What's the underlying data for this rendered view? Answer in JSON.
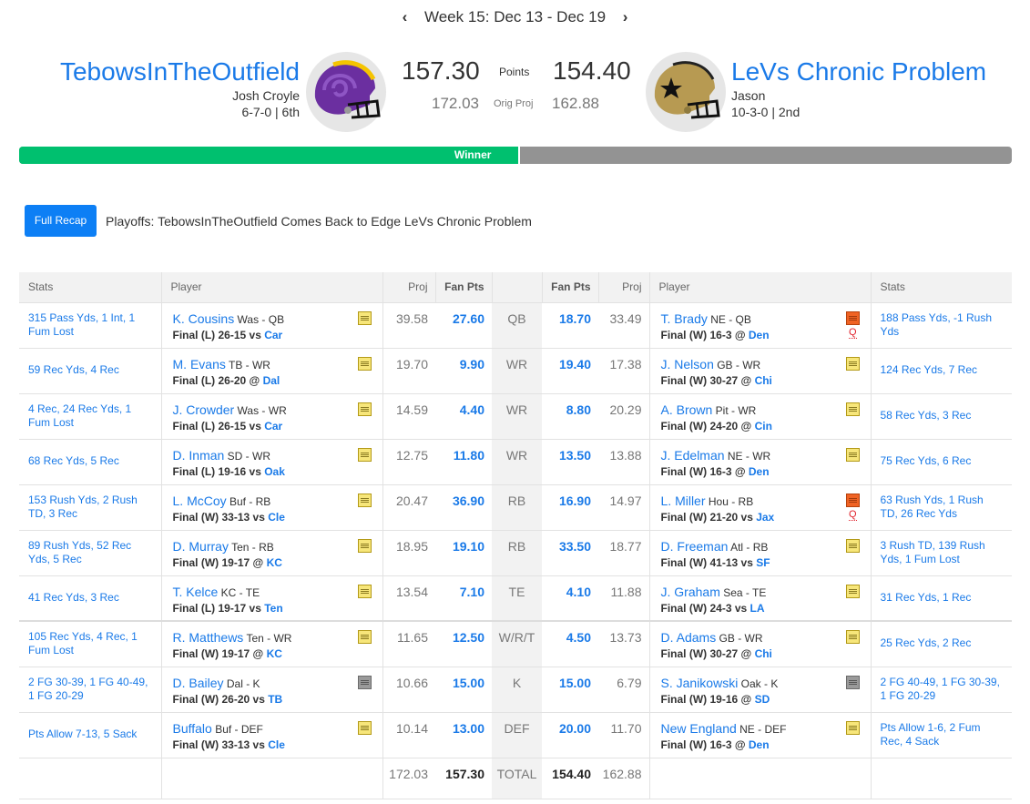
{
  "week_nav": {
    "prev_icon": "chevron-left-icon",
    "label": "Week 15: Dec 13 - Dec 19",
    "next_icon": "chevron-right-icon"
  },
  "matchup": {
    "left": {
      "team_name": "TebowsInTheOutfield",
      "owner": "Josh Croyle",
      "record": "6-7-0 | 6th",
      "helmet_colors": {
        "shell": "#6b2fa0",
        "stripe": "#f5c400"
      },
      "points": "157.30",
      "orig_proj": "172.03"
    },
    "right": {
      "team_name": "LeVs Chronic Problem",
      "owner": "Jason",
      "record": "10-3-0 | 2nd",
      "helmet_colors": {
        "shell": "#b79a52",
        "stripe": "#222222"
      },
      "points": "154.40",
      "orig_proj": "162.88"
    },
    "points_label": "Points",
    "orig_proj_label": "Orig Proj",
    "winner_label": "Winner",
    "winner_share_percent": 50.5,
    "colors": {
      "winner": "#00c06f",
      "loser": "#939393",
      "link": "#1a7ae8"
    }
  },
  "recap": {
    "button_label": "Full Recap",
    "headline": "Playoffs: TebowsInTheOutfield Comes Back to Edge LeVs Chronic Problem"
  },
  "table": {
    "headers": {
      "stats_left": "Stats",
      "player_left": "Player",
      "proj_left": "Proj",
      "fanpts_left": "Fan Pts",
      "pos": "",
      "fanpts_right": "Fan Pts",
      "proj_right": "Proj",
      "player_right": "Player",
      "stats_right": "Stats"
    },
    "rows": [
      {
        "pos": "QB",
        "left": {
          "stats": "315 Pass Yds, 1 Int, 1 Fum Lost",
          "name": "K. Cousins",
          "info": "Was - QB",
          "game": "Final (L) 26-15 vs ",
          "opp": "Car",
          "note": "yellow",
          "status": "",
          "proj": "39.58",
          "pts": "27.60"
        },
        "right": {
          "stats": "188 Pass Yds, -1 Rush Yds",
          "name": "T. Brady",
          "info": "NE - QB",
          "game": "Final (W) 16-3 @ ",
          "opp": "Den",
          "note": "orange",
          "status": "Q",
          "proj": "33.49",
          "pts": "18.70"
        }
      },
      {
        "pos": "WR",
        "left": {
          "stats": "59 Rec Yds, 4 Rec",
          "name": "M. Evans",
          "info": "TB - WR",
          "game": "Final (L) 26-20 @ ",
          "opp": "Dal",
          "note": "yellow",
          "status": "",
          "proj": "19.70",
          "pts": "9.90"
        },
        "right": {
          "stats": "124 Rec Yds, 7 Rec",
          "name": "J. Nelson",
          "info": "GB - WR",
          "game": "Final (W) 30-27 @ ",
          "opp": "Chi",
          "note": "yellow",
          "status": "",
          "proj": "17.38",
          "pts": "19.40"
        }
      },
      {
        "pos": "WR",
        "left": {
          "stats": "4 Rec, 24 Rec Yds, 1 Fum Lost",
          "name": "J. Crowder",
          "info": "Was - WR",
          "game": "Final (L) 26-15 vs ",
          "opp": "Car",
          "note": "yellow",
          "status": "",
          "proj": "14.59",
          "pts": "4.40"
        },
        "right": {
          "stats": "58 Rec Yds, 3 Rec",
          "name": "A. Brown",
          "info": "Pit - WR",
          "game": "Final (W) 24-20 @ ",
          "opp": "Cin",
          "note": "yellow",
          "status": "",
          "proj": "20.29",
          "pts": "8.80"
        }
      },
      {
        "pos": "WR",
        "left": {
          "stats": "68 Rec Yds, 5 Rec",
          "name": "D. Inman",
          "info": "SD - WR",
          "game": "Final (L) 19-16 vs ",
          "opp": "Oak",
          "note": "yellow",
          "status": "",
          "proj": "12.75",
          "pts": "11.80"
        },
        "right": {
          "stats": "75 Rec Yds, 6 Rec",
          "name": "J. Edelman",
          "info": "NE - WR",
          "game": "Final (W) 16-3 @ ",
          "opp": "Den",
          "note": "yellow",
          "status": "",
          "proj": "13.88",
          "pts": "13.50"
        }
      },
      {
        "pos": "RB",
        "left": {
          "stats": "153 Rush Yds, 2 Rush TD, 3 Rec",
          "name": "L. McCoy",
          "info": "Buf - RB",
          "game": "Final (W) 33-13 vs ",
          "opp": "Cle",
          "note": "yellow",
          "status": "",
          "proj": "20.47",
          "pts": "36.90"
        },
        "right": {
          "stats": "63 Rush Yds, 1 Rush TD, 26 Rec Yds",
          "name": "L. Miller",
          "info": "Hou - RB",
          "game": "Final (W) 21-20 vs ",
          "opp": "Jax",
          "note": "orange",
          "status": "Q",
          "proj": "14.97",
          "pts": "16.90"
        }
      },
      {
        "pos": "RB",
        "left": {
          "stats": "89 Rush Yds, 52 Rec Yds, 5 Rec",
          "name": "D. Murray",
          "info": "Ten - RB",
          "game": "Final (W) 19-17 @ ",
          "opp": "KC",
          "note": "yellow",
          "status": "",
          "proj": "18.95",
          "pts": "19.10"
        },
        "right": {
          "stats": "3 Rush TD, 139 Rush Yds, 1 Fum Lost",
          "name": "D. Freeman",
          "info": "Atl - RB",
          "game": "Final (W) 41-13 vs ",
          "opp": "SF",
          "note": "yellow",
          "status": "",
          "proj": "18.77",
          "pts": "33.50"
        }
      },
      {
        "pos": "TE",
        "left": {
          "stats": "41 Rec Yds, 3 Rec",
          "name": "T. Kelce",
          "info": "KC - TE",
          "game": "Final (L) 19-17 vs ",
          "opp": "Ten",
          "note": "yellow",
          "status": "",
          "proj": "13.54",
          "pts": "7.10"
        },
        "right": {
          "stats": "31 Rec Yds, 1 Rec",
          "name": "J. Graham",
          "info": "Sea - TE",
          "game": "Final (W) 24-3 vs ",
          "opp": "LA",
          "note": "yellow",
          "status": "",
          "proj": "11.88",
          "pts": "4.10"
        }
      },
      {
        "pos": "W/R/T",
        "left": {
          "stats": "105 Rec Yds, 4 Rec, 1 Fum Lost",
          "name": "R. Matthews",
          "info": "Ten - WR",
          "game": "Final (W) 19-17 @ ",
          "opp": "KC",
          "note": "yellow",
          "status": "",
          "proj": "11.65",
          "pts": "12.50"
        },
        "right": {
          "stats": "25 Rec Yds, 2 Rec",
          "name": "D. Adams",
          "info": "GB - WR",
          "game": "Final (W) 30-27 @ ",
          "opp": "Chi",
          "note": "yellow",
          "status": "",
          "proj": "13.73",
          "pts": "4.50"
        }
      },
      {
        "pos": "K",
        "left": {
          "stats": "2 FG 30-39, 1 FG 40-49, 1 FG 20-29",
          "name": "D. Bailey",
          "info": "Dal - K",
          "game": "Final (W) 26-20 vs ",
          "opp": "TB",
          "note": "gray",
          "status": "",
          "proj": "10.66",
          "pts": "15.00"
        },
        "right": {
          "stats": "2 FG 40-49, 1 FG 30-39, 1 FG 20-29",
          "name": "S. Janikowski",
          "info": "Oak - K",
          "game": "Final (W) 19-16 @ ",
          "opp": "SD",
          "note": "gray",
          "status": "",
          "proj": "6.79",
          "pts": "15.00"
        }
      },
      {
        "pos": "DEF",
        "left": {
          "stats": "Pts Allow 7-13, 5 Sack",
          "name": "Buffalo",
          "info": "Buf - DEF",
          "game": "Final (W) 33-13 vs ",
          "opp": "Cle",
          "note": "yellow",
          "status": "",
          "proj": "10.14",
          "pts": "13.00"
        },
        "right": {
          "stats": "Pts Allow 1-6, 2 Fum Rec, 4 Sack",
          "name": "New England",
          "info": "NE - DEF",
          "game": "Final (W) 16-3 @ ",
          "opp": "Den",
          "note": "yellow",
          "status": "",
          "proj": "11.70",
          "pts": "20.00"
        }
      }
    ],
    "total": {
      "label": "TOTAL",
      "left_proj": "172.03",
      "left_pts": "157.30",
      "right_pts": "154.40",
      "right_proj": "162.88"
    }
  }
}
